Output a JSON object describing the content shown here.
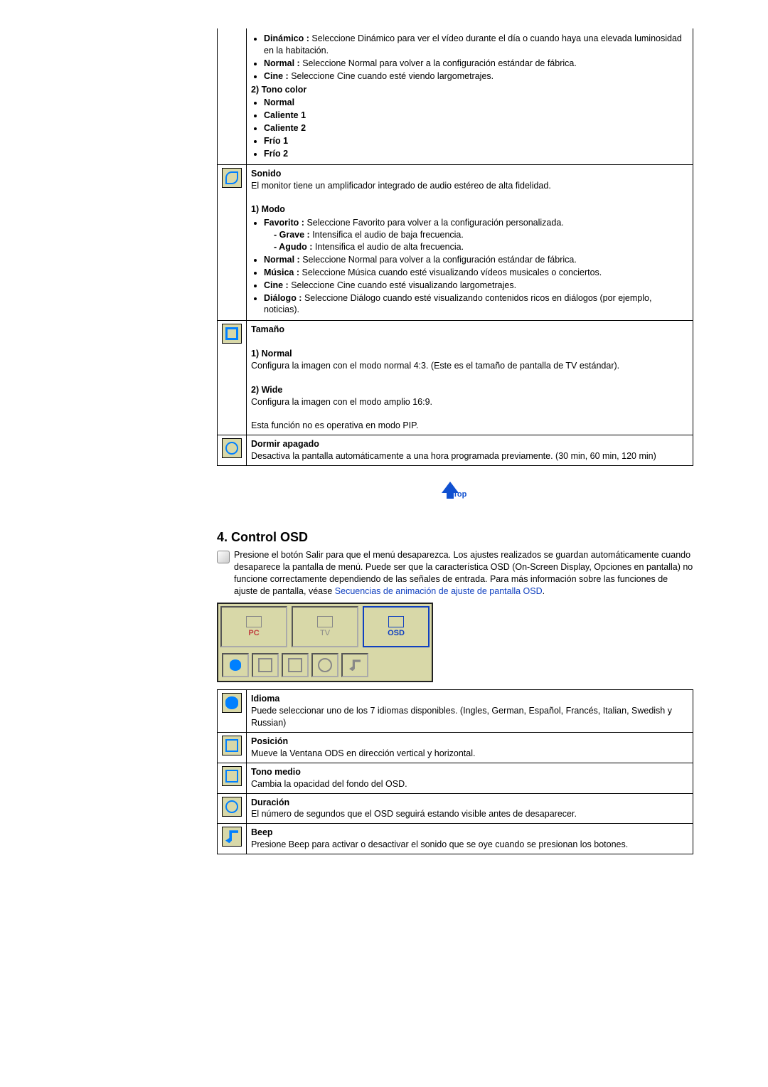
{
  "image": {
    "modo_items": [
      {
        "label": "Dinámico :",
        "desc": "Seleccione Dinámico para ver el vídeo durante el día o cuando haya una elevada luminosidad en la habitación."
      },
      {
        "label": "Normal :",
        "desc": "Seleccione Normal para volver a la configuración estándar de fábrica."
      },
      {
        "label": "Cine :",
        "desc": "Seleccione Cine cuando esté viendo largometrajes."
      }
    ],
    "tono_heading": "2) Tono color",
    "tono_items": [
      "Normal",
      "Caliente 1",
      "Caliente 2",
      "Frío 1",
      "Frío 2"
    ]
  },
  "sound": {
    "title": "Sonido",
    "desc": "El monitor tiene un amplificador integrado de audio estéreo de alta fidelidad.",
    "modo_heading": "1) Modo",
    "items": [
      {
        "label": "Favorito :",
        "desc": "Seleccione Favorito para volver a la configuración personalizada.",
        "subs": [
          {
            "label": "- Grave :",
            "desc": "Intensifica el audio de baja frecuencia."
          },
          {
            "label": "- Agudo :",
            "desc": "Intensifica el audio de alta frecuencia."
          }
        ]
      },
      {
        "label": "Normal :",
        "desc": "Seleccione Normal para volver a la configuración estándar de fábrica."
      },
      {
        "label": "Música :",
        "desc": "Seleccione Música cuando esté visualizando vídeos musicales o conciertos."
      },
      {
        "label": "Cine :",
        "desc": "Seleccione Cine cuando esté visualizando largometrajes."
      },
      {
        "label": "Diálogo :",
        "desc": "Seleccione Diálogo cuando esté visualizando contenidos ricos en diálogos (por ejemplo, noticias)."
      }
    ]
  },
  "size": {
    "title": "Tamaño",
    "items": [
      {
        "heading": "1) Normal",
        "desc": "Configura la imagen con el modo normal 4:3. (Este es el tamaño de pantalla de TV estándar)."
      },
      {
        "heading": "2) Wide",
        "desc": "Configura la imagen con el modo amplio 16:9."
      }
    ],
    "note": "Esta función no es operativa en modo PIP."
  },
  "sleep": {
    "title": "Dormir apagado",
    "desc": "Desactiva la pantalla automáticamente a una hora programada previamente. (30 min, 60 min, 120 min)"
  },
  "section4": {
    "heading": "4. Control OSD",
    "intro": "Presione el botón Salir para que el menú desaparezca. Los ajustes realizados se guardan automáticamente cuando desaparece la pantalla de menú. Puede ser que la característica OSD (On-Screen Display, Opciones en pantalla) no funcione correctamente dependiendo de las señales de entrada. Para más información sobre las funciones de ajuste de pantalla, véase ",
    "link": "Secuencias de animación de ajuste de pantalla OSD",
    "tabs": [
      "PC",
      "TV",
      "OSD"
    ]
  },
  "osd_rows": [
    {
      "title": "Idioma",
      "desc": "Puede seleccionar uno de los 7 idiomas disponibles. (Ingles, German, Español, Francés, Italian, Swedish y Russian)",
      "shape": "shape-eye"
    },
    {
      "title": "Posición",
      "desc": "Mueve la Ventana ODS en dirección vertical y horizontal.",
      "shape": "shape-pos"
    },
    {
      "title": "Tono medio",
      "desc": "Cambia la opacidad del fondo del OSD.",
      "shape": "shape-half"
    },
    {
      "title": "Duración",
      "desc": "El número de segundos que el OSD seguirá estando visible antes de desaparecer.",
      "shape": "shape-clock"
    },
    {
      "title": "Beep",
      "desc": "Presione Beep para activar o desactivar el sonido que se oye cuando se presionan los botones.",
      "shape": "shape-note"
    }
  ],
  "top_label": "Top"
}
